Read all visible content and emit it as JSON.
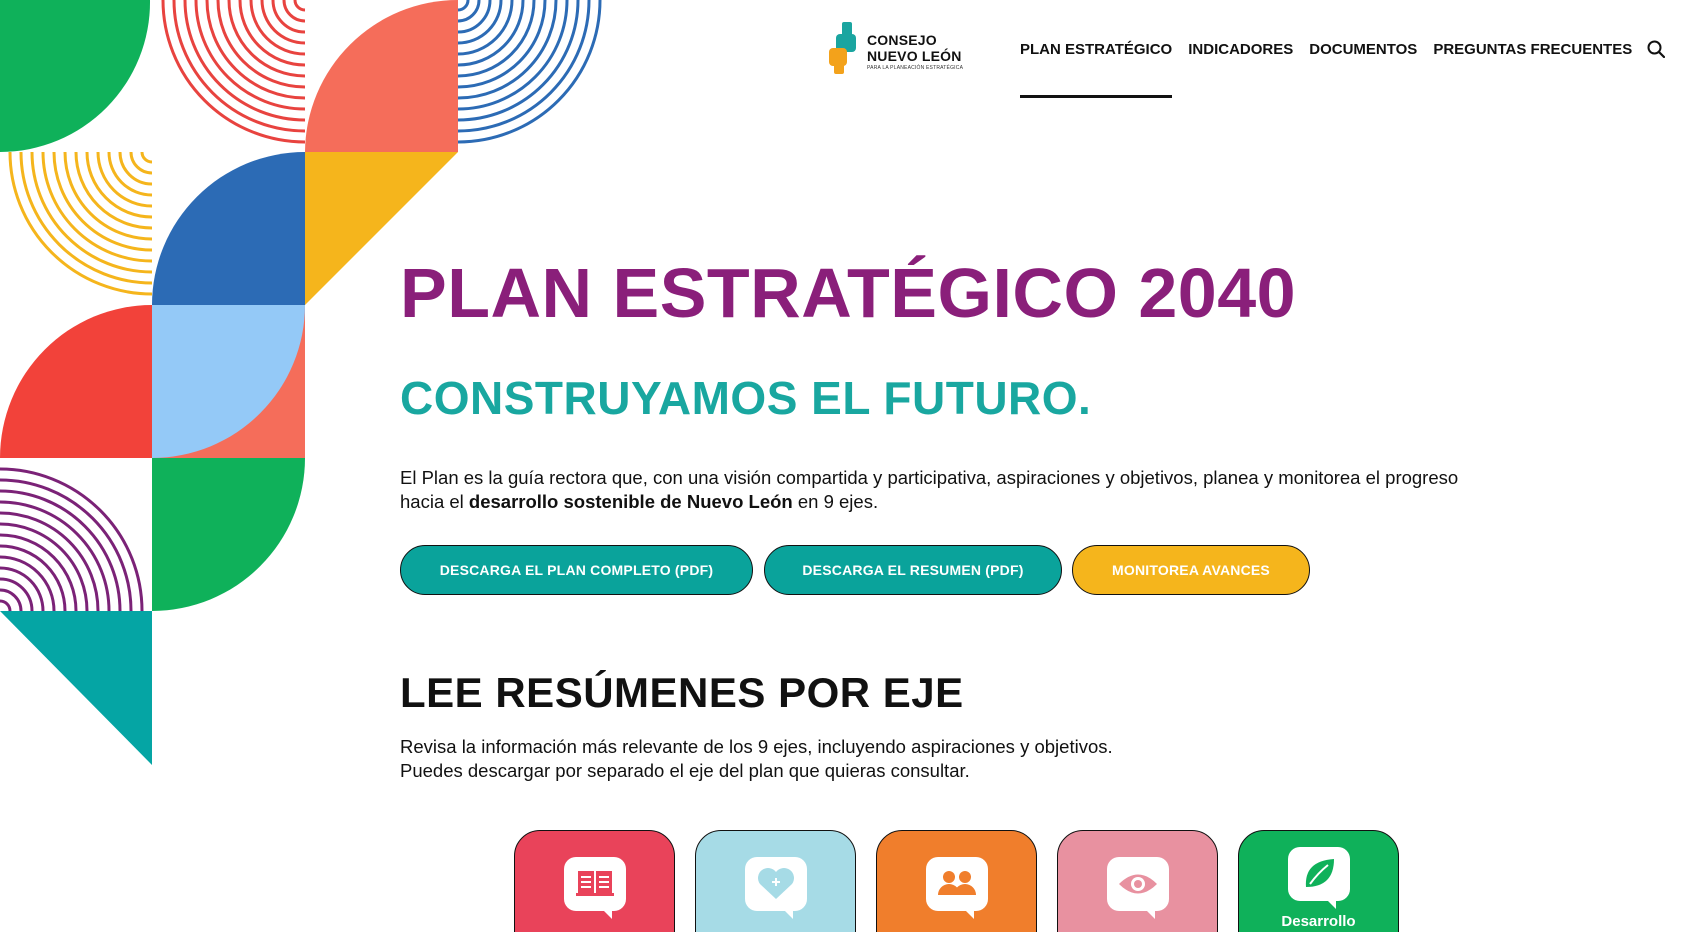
{
  "logo": {
    "line1": "CONSEJO",
    "line2": "NUEVO LEÓN",
    "line3": "PARA LA PLANEACIÓN ESTRATÉGICA"
  },
  "nav": {
    "items": [
      {
        "label": "PLAN ESTRATÉGICO",
        "active": true
      },
      {
        "label": "INDICADORES"
      },
      {
        "label": "DOCUMENTOS"
      },
      {
        "label": "PREGUNTAS FRECUENTES"
      }
    ],
    "search_icon": "search-icon"
  },
  "hero": {
    "title": "PLAN ESTRATÉGICO 2040",
    "subtitle": "CONSTRUYAMOS EL FUTURO.",
    "desc_part1": "El Plan es la guía rectora que, con una visión compartida y participativa, aspiraciones y objetivos, planea y monitorea el progreso hacia el ",
    "desc_bold": "desarrollo sostenible de Nuevo León",
    "desc_part2": " en 9 ejes."
  },
  "buttons": {
    "download_plan": "DESCARGA EL PLAN COMPLETO (PDF)",
    "download_summary": "DESCARGA EL RESUMEN (PDF)",
    "monitor": "MONITOREA AVANCES"
  },
  "section": {
    "title": "LEE RESÚMENES POR EJE",
    "line1": "Revisa la información más relevante de los 9 ejes, incluyendo aspiraciones y objetivos.",
    "line2": "Puedes descargar por separado el eje del plan que quieras consultar."
  },
  "cards": [
    {
      "icon": "book-icon",
      "color": "#e9435a",
      "label": ""
    },
    {
      "icon": "heart-icon",
      "color": "#a6dbe6",
      "label": ""
    },
    {
      "icon": "people-icon",
      "color": "#f07e2c",
      "label": ""
    },
    {
      "icon": "eye-icon",
      "color": "#e891a0",
      "label": ""
    },
    {
      "icon": "leaf-icon",
      "color": "#0fb15a",
      "label": "Desarrollo"
    }
  ],
  "colors": {
    "purple": "#8a1f7a",
    "teal": "#19a7a0",
    "button_teal": "#0aa39b",
    "button_yellow": "#f5b51c"
  }
}
